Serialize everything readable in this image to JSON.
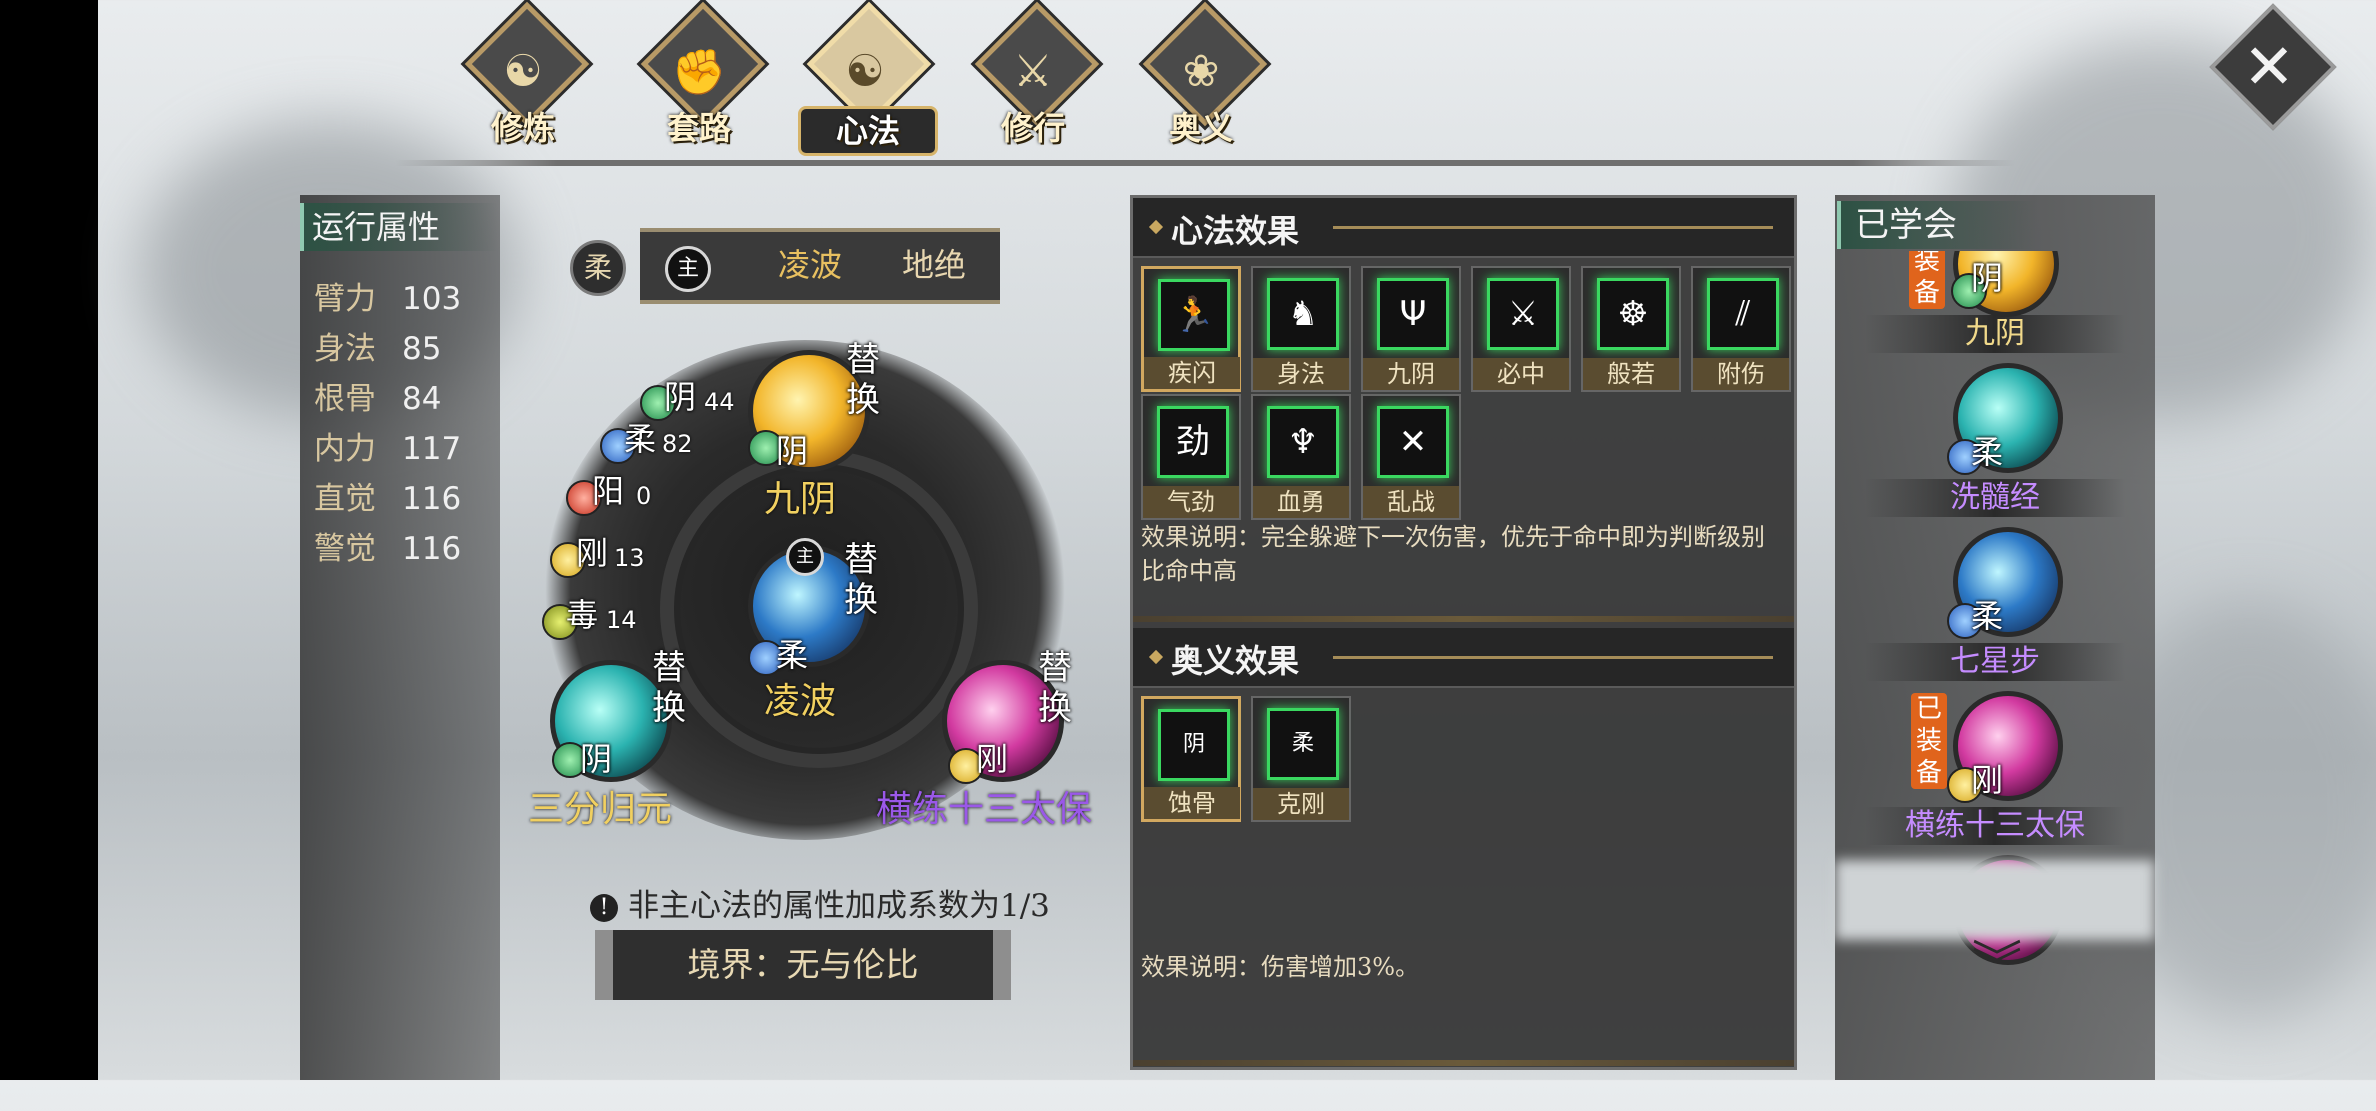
{
  "nav": {
    "tabs": [
      {
        "label": "修炼",
        "icon": "yin-yang-flame-icon"
      },
      {
        "label": "套路",
        "icon": "fist-icon"
      },
      {
        "label": "心法",
        "icon": "taiji-swirl-icon",
        "active": true
      },
      {
        "label": "修行",
        "icon": "scroll-sword-icon"
      },
      {
        "label": "奥义",
        "icon": "lotus-flame-icon"
      }
    ],
    "close_icon": "close-x-icon"
  },
  "attributes": {
    "title": "运行属性",
    "items": [
      {
        "name": "臂力",
        "value": "103"
      },
      {
        "name": "身法",
        "value": "85"
      },
      {
        "name": "根骨",
        "value": "84"
      },
      {
        "name": "内力",
        "value": "117"
      },
      {
        "name": "直觉",
        "value": "116"
      },
      {
        "name": "警觉",
        "value": "116"
      }
    ]
  },
  "center": {
    "rou_badge": "柔",
    "zhu_badge": "主",
    "tab_primary": "凌波",
    "tab_secondary": "地绝",
    "elements": [
      {
        "char": "阴",
        "value": "44",
        "color": "#1e8a4a"
      },
      {
        "char": "柔",
        "value": "82",
        "color": "#2a5fbf"
      },
      {
        "char": "阳",
        "value": "0",
        "color": "#c6301e"
      },
      {
        "char": "刚",
        "value": "13",
        "color": "#d6a61a"
      },
      {
        "char": "毒",
        "value": "14",
        "color": "#7c8a1a"
      }
    ],
    "swap_label": "替换",
    "skills": {
      "top": {
        "name": "九阴",
        "tag": "阴"
      },
      "center": {
        "name": "凌波",
        "tag": "柔",
        "zhu": "主"
      },
      "left": {
        "name": "三分归元",
        "tag": "阴"
      },
      "right": {
        "name": "横练十三太保",
        "tag": "刚"
      }
    },
    "note": "非主心法的属性加成系数为1/3",
    "realm": "境界：无与伦比"
  },
  "effects": {
    "xinfa_title": "心法效果",
    "xinfa_items": [
      {
        "label": "疾闪",
        "glyph": "🏃",
        "selected": true
      },
      {
        "label": "身法",
        "glyph": "♞"
      },
      {
        "label": "九阴",
        "glyph": "Ψ"
      },
      {
        "label": "必中",
        "glyph": "⚔"
      },
      {
        "label": "般若",
        "glyph": "☸"
      },
      {
        "label": "附伤",
        "glyph": "⫽"
      },
      {
        "label": "气劲",
        "glyph": "劲"
      },
      {
        "label": "血勇",
        "glyph": "♆"
      },
      {
        "label": "乱战",
        "glyph": "✕"
      }
    ],
    "xinfa_desc": "效果说明：完全躲避下一次伤害，优先于命中即为判断级别比命中高",
    "aoyi_title": "奥义效果",
    "aoyi_items": [
      {
        "label": "蚀骨",
        "glyph": "阴",
        "selected": true
      },
      {
        "label": "克刚",
        "glyph": "柔"
      }
    ],
    "aoyi_desc": "效果说明：伤害增加3%。"
  },
  "learned": {
    "title": "已学会",
    "items": [
      {
        "name": "九阴",
        "tag": "阴",
        "equipped": "装备",
        "orb": "gold",
        "name_color": "#f1d98a"
      },
      {
        "name": "洗髓经",
        "tag": "柔",
        "orb": "teal",
        "name_color": "#c58cff"
      },
      {
        "name": "七星步",
        "tag": "柔",
        "orb": "blue",
        "name_color": "#c58cff"
      },
      {
        "name": "横练十三太保",
        "tag": "刚",
        "equipped": "已装备",
        "orb": "pink",
        "name_color": "#c58cff"
      }
    ],
    "scroll_icon": "double-chevron-down-icon"
  }
}
